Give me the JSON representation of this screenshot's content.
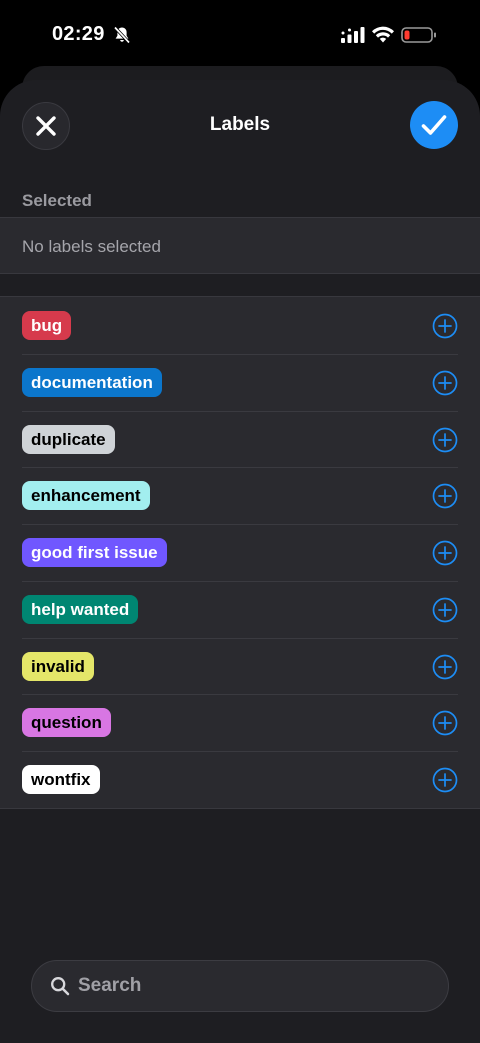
{
  "status_bar": {
    "time": "02:29",
    "icons": [
      "bell-slash-icon",
      "cellular-signal-icon",
      "wifi-icon",
      "battery-low-icon"
    ]
  },
  "header": {
    "title": "Labels",
    "close_icon": "close-icon",
    "done_icon": "checkmark-icon"
  },
  "selected_section": {
    "header": "Selected",
    "empty_text": "No labels selected"
  },
  "labels": [
    {
      "name": "bug",
      "bg": "#d63a4c",
      "fg": "#ffffff"
    },
    {
      "name": "documentation",
      "bg": "#0b76cc",
      "fg": "#ffffff"
    },
    {
      "name": "duplicate",
      "bg": "#cfd3d7",
      "fg": "#000000"
    },
    {
      "name": "enhancement",
      "bg": "#a2eeef",
      "fg": "#000000"
    },
    {
      "name": "good first issue",
      "bg": "#7057ff",
      "fg": "#ffffff"
    },
    {
      "name": "help wanted",
      "bg": "#008672",
      "fg": "#ffffff"
    },
    {
      "name": "invalid",
      "bg": "#e4e669",
      "fg": "#000000"
    },
    {
      "name": "question",
      "bg": "#d876e3",
      "fg": "#000000"
    },
    {
      "name": "wontfix",
      "bg": "#ffffff",
      "fg": "#000000"
    }
  ],
  "add_icon": "plus-circle-icon",
  "search": {
    "placeholder": "Search",
    "value": ""
  },
  "colors": {
    "accent": "#1d8df5",
    "background": "#1e1e22",
    "row_background": "#2a2a2f"
  }
}
